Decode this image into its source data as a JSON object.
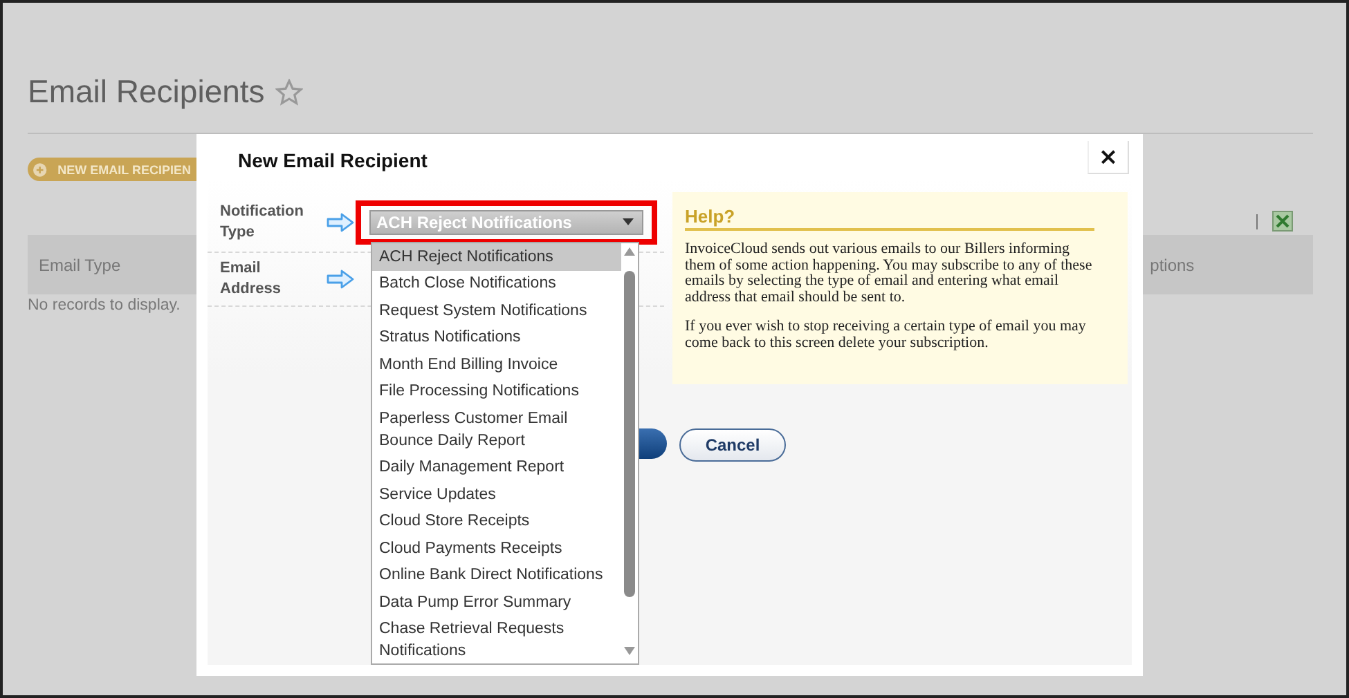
{
  "page": {
    "title": "Email Recipients",
    "new_button": "NEW EMAIL RECIPIEN",
    "table": {
      "columns": [
        "Email Type",
        "ptions"
      ]
    },
    "empty_message": "No records to display."
  },
  "dialog": {
    "title": "New Email Recipient",
    "close": "×",
    "fields": [
      {
        "label": "Notification Type",
        "value": "ACH Reject Notifications"
      },
      {
        "label": "Email Address"
      }
    ],
    "dropdown": {
      "options": [
        {
          "lines": [
            "ACH Reject Notifications"
          ],
          "selected": true
        },
        {
          "lines": [
            "Batch Close Notifications"
          ],
          "selected": false
        },
        {
          "lines": [
            "Request System Notifications"
          ],
          "selected": false
        },
        {
          "lines": [
            "Stratus Notifications"
          ],
          "selected": false
        },
        {
          "lines": [
            "Month End Billing Invoice"
          ],
          "selected": false
        },
        {
          "lines": [
            "File Processing Notifications"
          ],
          "selected": false
        },
        {
          "lines": [
            "Paperless Customer Email",
            "Bounce Daily Report"
          ],
          "selected": false
        },
        {
          "lines": [
            "Daily Management Report"
          ],
          "selected": false
        },
        {
          "lines": [
            "Service Updates"
          ],
          "selected": false
        },
        {
          "lines": [
            "Cloud Store Receipts"
          ],
          "selected": false
        },
        {
          "lines": [
            "Cloud Payments Receipts"
          ],
          "selected": false
        },
        {
          "lines": [
            "Online Bank Direct Notifications"
          ],
          "selected": false
        },
        {
          "lines": [
            "Data Pump Error Summary"
          ],
          "selected": false
        },
        {
          "lines": [
            "Chase Retrieval Requests",
            "Notifications"
          ],
          "selected": false
        }
      ]
    },
    "help": {
      "title": "Help?",
      "paragraphs": [
        "InvoiceCloud sends out various emails to our Billers informing them of some action happening. You may subscribe to any of these emails by selecting the type of email and entering what email address that email should be sent to.",
        "If you ever wish to stop receiving a certain type of email you may come back to this screen delete your subscription."
      ]
    },
    "buttons": [
      "Cancel"
    ]
  }
}
